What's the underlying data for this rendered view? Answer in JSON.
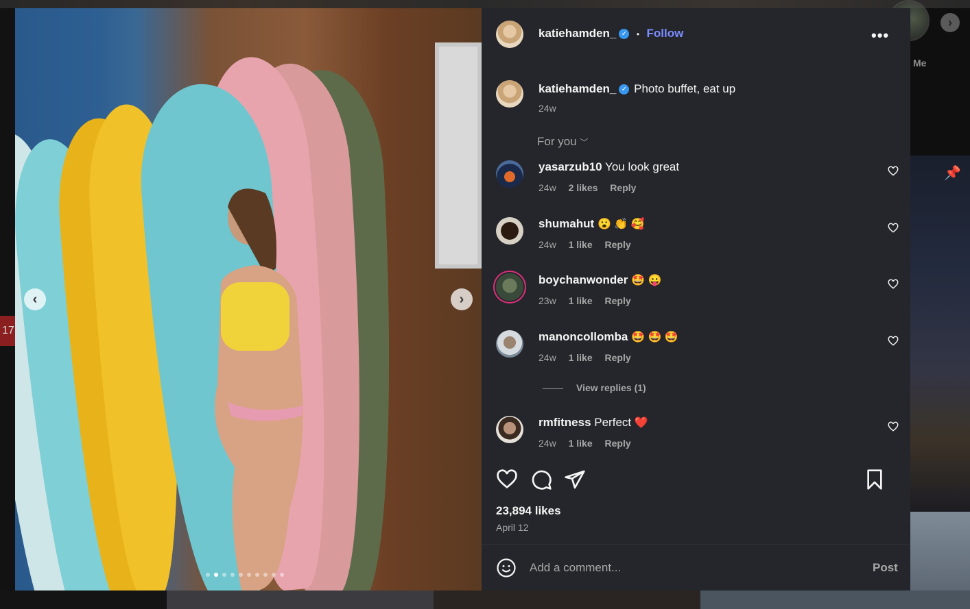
{
  "post": {
    "username": "katiehamden_",
    "follow_label": "Follow",
    "separator": "•",
    "caption": "Photo buffet, eat up",
    "caption_age": "24w",
    "carousel": {
      "active_index": 1,
      "total": 10
    }
  },
  "comments_filter": "For you",
  "comments": [
    {
      "username": "yasarzub10",
      "text": "You look great",
      "emoji": "",
      "age": "24w",
      "likes": "2 likes",
      "reply": "Reply"
    },
    {
      "username": "shumahut",
      "text": "",
      "emoji": "😮 👏 🥰",
      "age": "24w",
      "likes": "1 like",
      "reply": "Reply"
    },
    {
      "username": "boychanwonder",
      "text": "",
      "emoji": "🤩 😛",
      "age": "23w",
      "likes": "1 like",
      "reply": "Reply"
    },
    {
      "username": "manoncollomba",
      "text": "",
      "emoji": "🤩 🤩 🤩",
      "age": "24w",
      "likes": "1 like",
      "reply": "Reply",
      "view_replies": "View replies (1)"
    },
    {
      "username": "rmfitness",
      "text": "Perfect",
      "emoji": "❤️",
      "age": "24w",
      "likes": "1 like",
      "reply": "Reply"
    }
  ],
  "stats": {
    "likes": "23,894 likes",
    "date": "April 12"
  },
  "composer": {
    "placeholder": "Add a comment...",
    "post_label": "Post"
  },
  "background": {
    "me_label": "Me",
    "badge": "17"
  },
  "colors": {
    "panel": "#25262b",
    "accent": "#7a8cff",
    "verified": "#3897f0",
    "muted": "#a8a8a8"
  }
}
